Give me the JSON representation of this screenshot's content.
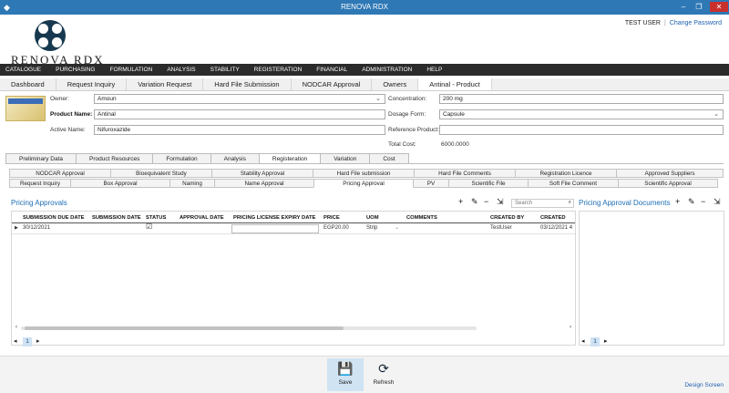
{
  "window": {
    "title": "RENOVA RDX",
    "minimize": "–",
    "maximize": "❐",
    "close": "✕",
    "app_icon": "app-icon"
  },
  "header": {
    "logo_text": "RENOVA RDX",
    "user": "TEST USER",
    "separator": "|",
    "change_password": "Change Password"
  },
  "menu": [
    "CATALOGUE",
    "PURCHASING",
    "FORMULATION",
    "ANALYSIS",
    "STABILITY",
    "REGISTERATION",
    "FINANCIAL",
    "ADMINISTRATION",
    "HELP"
  ],
  "module_tabs": [
    "Dashboard",
    "Request Inquiry",
    "Variation Request",
    "Hard File Submission",
    "NODCAR Approval",
    "Owners",
    "Antinal - Product"
  ],
  "product": {
    "owner_label": "Owner:",
    "owner_value": "Amoun",
    "name_label": "Product Name:",
    "name_value": "Antinal",
    "active_label": "Active Name:",
    "active_value": "Nifuroxazide",
    "concentration_label": "Concentration:",
    "concentration_value": "200 mg",
    "dosage_label": "Dosage Form:",
    "dosage_value": "Capsule",
    "reference_label": "Reference Product:",
    "reference_value": "",
    "total_cost_label": "Total Cost:",
    "total_cost_value": "6000.0000"
  },
  "tabs_level1": [
    "Preliminary Data",
    "Product Resources",
    "Formulation",
    "Analysis",
    "Registeration",
    "Variation",
    "Cost"
  ],
  "tabs_row_top": [
    "NODCAR Approval",
    "Bioequivalent Study",
    "Stability Approval",
    "Hard File submission",
    "Hard File Comments",
    "Registration Licence",
    "Approved Suppliers"
  ],
  "tabs_row_bottom": [
    "Request Inquiry",
    "Box Approval",
    "Naming",
    "Name Approval",
    "Pricing Approval",
    "PV",
    "Scientific File",
    "Soft File Comment",
    "Scientific Approval"
  ],
  "pricing": {
    "title": "Pricing Approvals",
    "search_placeholder": "Search",
    "columns": [
      "SUBMISSION DUE DATE",
      "SUBMISSION DATE",
      "STATUS",
      "APPROVAL DATE",
      "PRICING LICENSE EXPIRY DATE",
      "PRICE",
      "UOM",
      "COMMENTS",
      "CREATED BY",
      "CREATED"
    ],
    "rows": [
      {
        "marker": "▶",
        "due": "30/12/2021",
        "submission": "",
        "status": "☑",
        "approval": "",
        "expiry": "",
        "price": "EGP20.00",
        "uom": "Strip",
        "comments": "",
        "created_by": "TestUser",
        "created": "03/12/2021 4"
      }
    ],
    "page": "1"
  },
  "docs": {
    "title": "Pricing Approval Documents",
    "page": "1"
  },
  "bottom": {
    "save": "Save",
    "refresh": "Refresh",
    "design_screen": "Design Screen"
  }
}
